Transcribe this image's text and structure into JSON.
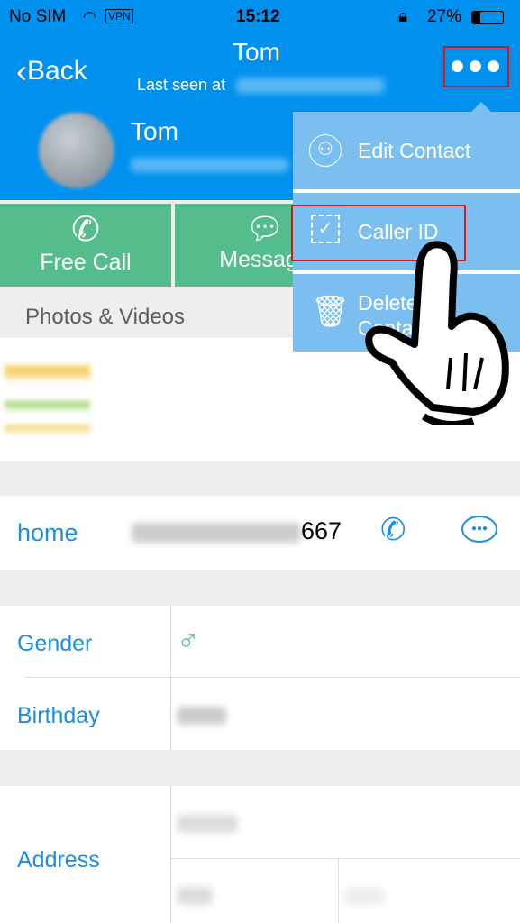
{
  "status_bar": {
    "carrier": "No SIM",
    "vpn": "VPN",
    "time": "15:12",
    "battery": "27%",
    "battery_level": 0.27
  },
  "nav": {
    "back_label": "Back",
    "title": "Tom",
    "subtitle": "Last seen at",
    "more_icon": "ellipsis-icon"
  },
  "profile": {
    "name": "Tom"
  },
  "actions": [
    {
      "label": "Free Call",
      "icon": "phone-icon"
    },
    {
      "label": "Message",
      "icon": "chat-bubble-icon"
    }
  ],
  "photos": {
    "title": "Photos & Videos"
  },
  "phone": {
    "label": "home",
    "number_visible": "667"
  },
  "info": {
    "gender_label": "Gender",
    "birthday_label": "Birthday",
    "address_label": "Address"
  },
  "menu": {
    "items": [
      {
        "label": "Edit Contact",
        "icon": "person-icon"
      },
      {
        "label": "Caller ID",
        "icon": "checkbox-icon"
      },
      {
        "label": "Delete Contact",
        "icon": "trash-icon"
      }
    ]
  },
  "colors": {
    "header": "#0091ef",
    "action": "#55bd8c",
    "menu": "#7bbff0",
    "link": "#1a8fe3",
    "highlight": "#e0131b"
  }
}
